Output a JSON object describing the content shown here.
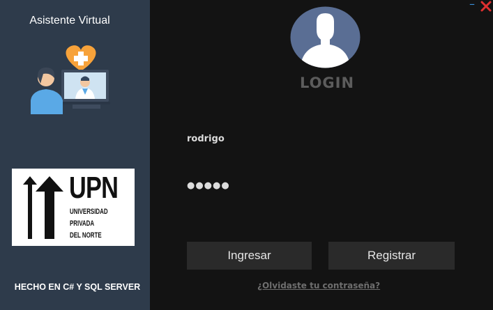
{
  "sidebar": {
    "title": "Asistente Virtual",
    "logo": {
      "name": "UPN",
      "line1": "UNIVERSIDAD",
      "line2": "PRIVADA",
      "line3": "DEL NORTE"
    },
    "footer": "HECHO EN C# Y SQL SERVER"
  },
  "window": {
    "minimize": "–",
    "close_icon": "close-icon"
  },
  "login": {
    "title": "LOGIN",
    "username": "rodrigo",
    "password_mask": "●●●●●",
    "ingresar_label": "Ingresar",
    "registrar_label": "Registrar",
    "forgot_label": "¿Olvidaste tu contraseña?"
  },
  "colors": {
    "sidebar_bg": "#2e3b4b",
    "main_bg": "#131313",
    "button_bg": "#2a2a2a",
    "close_red": "#e03030",
    "minimize_blue": "#3a8fd9",
    "avatar_circle": "#5a6e94"
  }
}
